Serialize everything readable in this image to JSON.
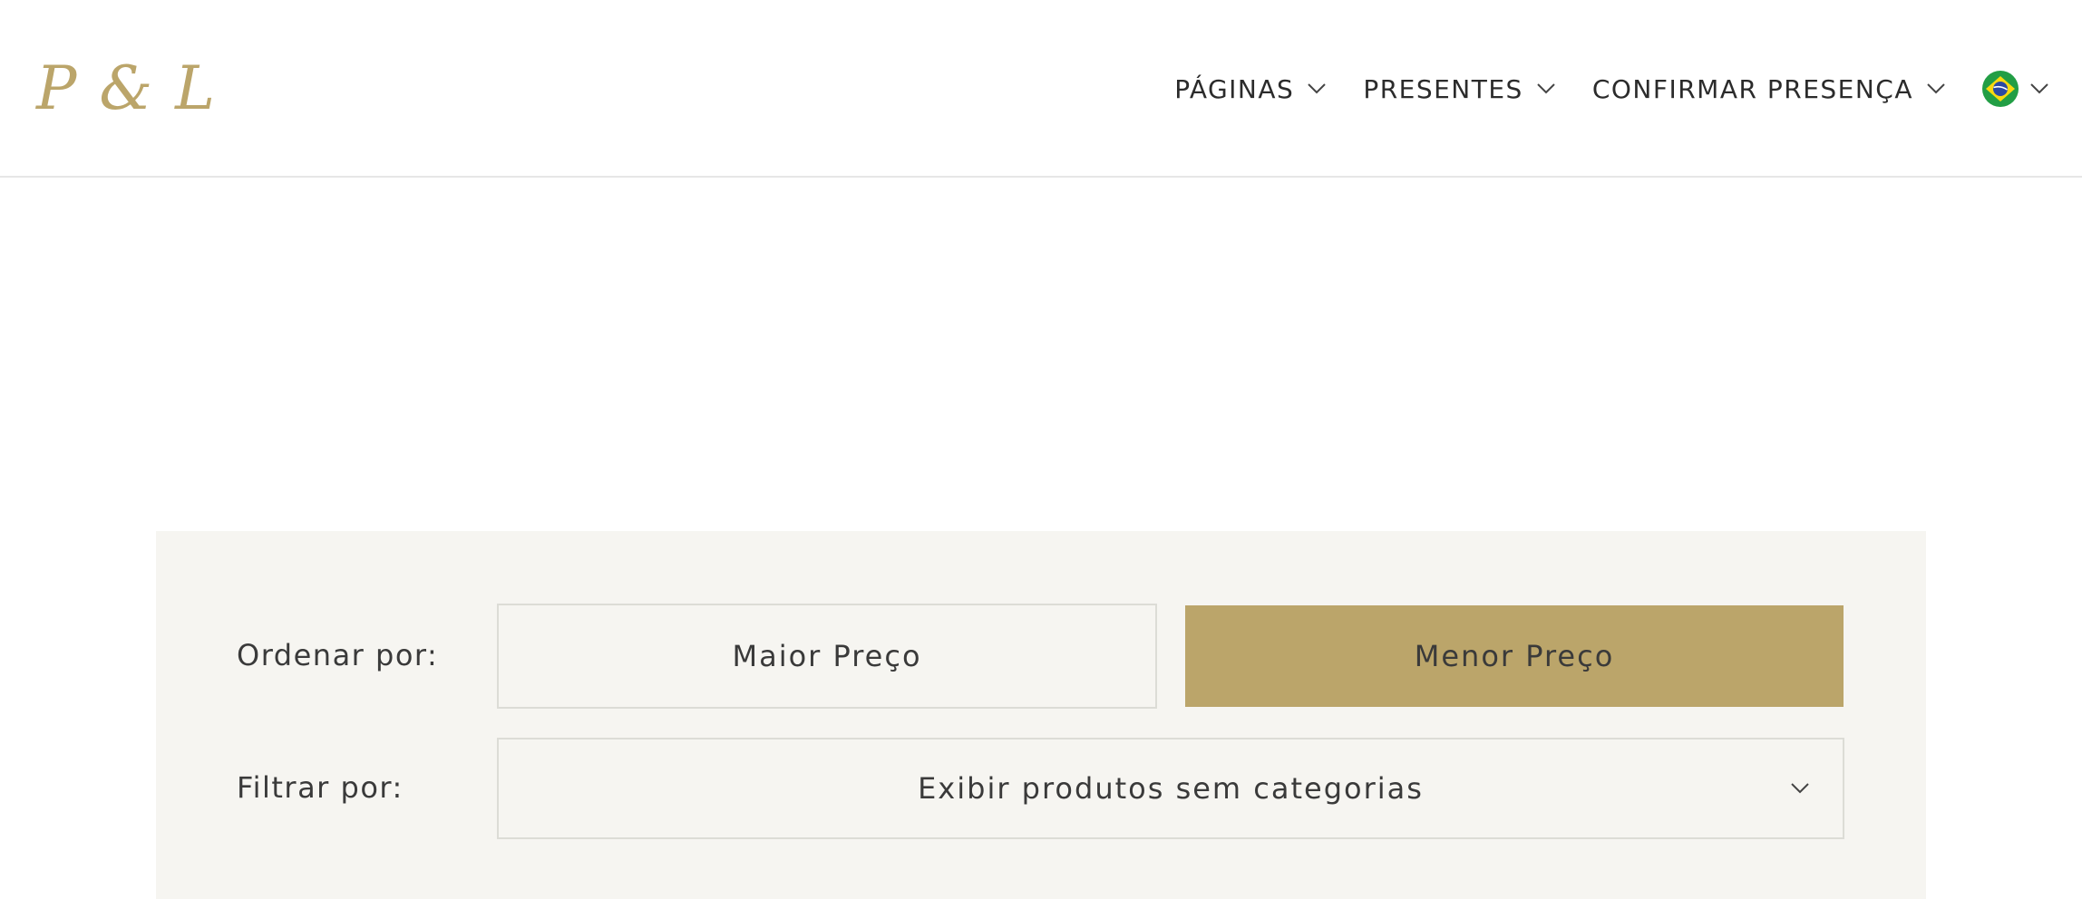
{
  "header": {
    "logo": "P & L",
    "nav": [
      {
        "label": "PÁGINAS",
        "icon": "chevron-down-icon"
      },
      {
        "label": "PRESENTES",
        "icon": "chevron-down-icon"
      },
      {
        "label": "CONFIRMAR PRESENÇA",
        "icon": "chevron-down-icon"
      }
    ],
    "language": {
      "icon": "brazil-flag-icon",
      "dropdown_icon": "chevron-down-icon"
    }
  },
  "filters": {
    "sort_label": "Ordenar por:",
    "sort_options": [
      {
        "label": "Maior Preço",
        "selected": false
      },
      {
        "label": "Menor Preço",
        "selected": true
      }
    ],
    "filter_label": "Filtrar por:",
    "filter_value": "Exibir produtos sem categorias"
  },
  "colors": {
    "accent": "#bba56a",
    "panel_bg": "#f6f5f1",
    "text": "#2b2b2b"
  }
}
